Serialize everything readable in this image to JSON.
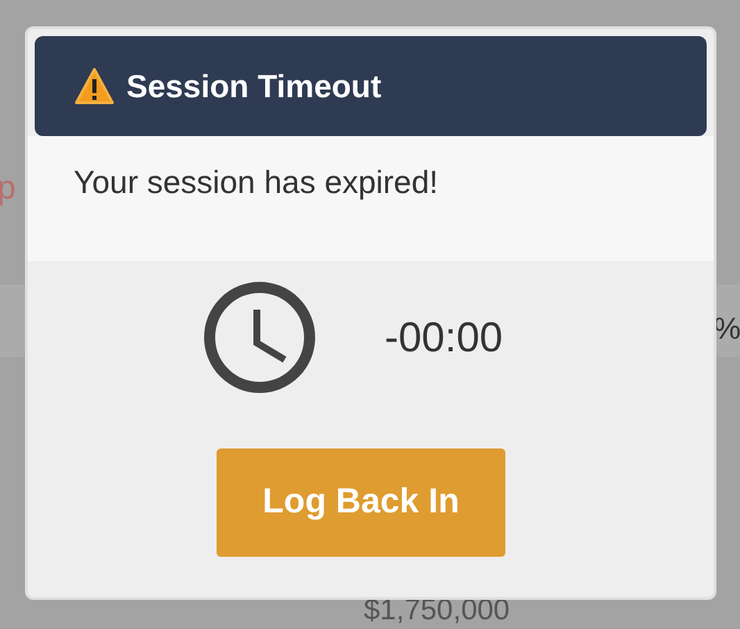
{
  "background": {
    "partial_text": "p",
    "percent_sign": "%",
    "amount": "$1,750,000"
  },
  "dialog": {
    "title": "Session Timeout",
    "message": "Your session has expired!",
    "countdown": "-00:00",
    "button": "Log Back In"
  }
}
